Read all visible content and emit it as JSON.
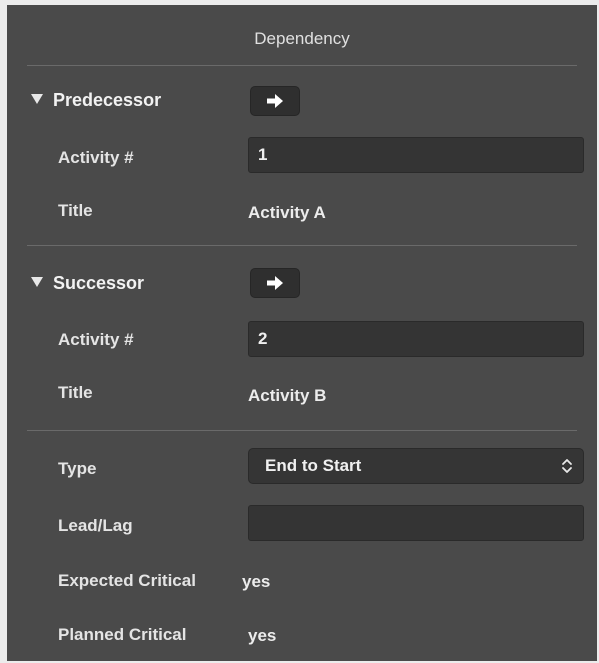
{
  "panel": {
    "title": "Dependency"
  },
  "predecessor": {
    "heading": "Predecessor",
    "activity_label": "Activity #",
    "activity_value": "1",
    "title_label": "Title",
    "title_value": "Activity A"
  },
  "successor": {
    "heading": "Successor",
    "activity_label": "Activity #",
    "activity_value": "2",
    "title_label": "Title",
    "title_value": "Activity B"
  },
  "details": {
    "type_label": "Type",
    "type_value": "End to Start",
    "leadlag_label": "Lead/Lag",
    "leadlag_value": "",
    "expected_label": "Expected Critical",
    "expected_value": "yes",
    "planned_label": "Planned Critical",
    "planned_value": "yes"
  },
  "colors": {
    "panel_bg": "#4a4a4a",
    "field_bg": "#343434",
    "text": "#e6e6e6"
  }
}
